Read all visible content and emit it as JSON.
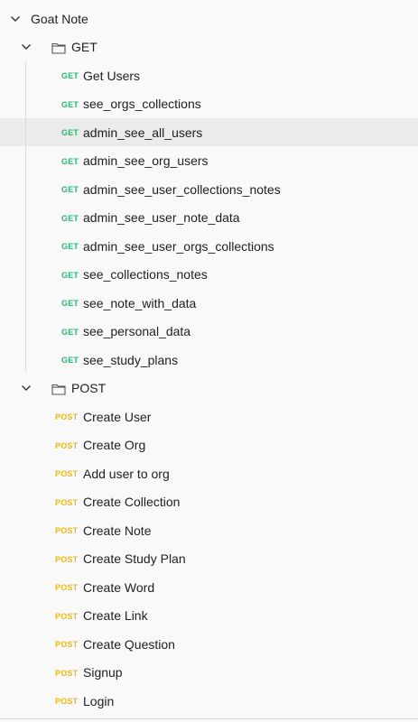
{
  "collection": {
    "name": "Goat Note",
    "expanded": true
  },
  "folders": [
    {
      "name": "GET",
      "method_label": "GET",
      "color": "#2bb673",
      "requests": [
        {
          "name": "Get Users"
        },
        {
          "name": "see_orgs_collections"
        },
        {
          "name": "admin_see_all_users",
          "selected": true
        },
        {
          "name": "admin_see_org_users"
        },
        {
          "name": "admin_see_user_collections_notes"
        },
        {
          "name": "admin_see_user_note_data"
        },
        {
          "name": "admin_see_user_orgs_collections"
        },
        {
          "name": "see_collections_notes"
        },
        {
          "name": "see_note_with_data"
        },
        {
          "name": "see_personal_data"
        },
        {
          "name": "see_study_plans"
        }
      ]
    },
    {
      "name": "POST",
      "method_label": "POST",
      "color": "#f1b80f",
      "requests": [
        {
          "name": "Create User"
        },
        {
          "name": "Create Org"
        },
        {
          "name": "Add user to org"
        },
        {
          "name": "Create Collection"
        },
        {
          "name": "Create Note"
        },
        {
          "name": "Create Study Plan"
        },
        {
          "name": "Create Word"
        },
        {
          "name": "Create Link"
        },
        {
          "name": "Create Question"
        },
        {
          "name": "Signup"
        },
        {
          "name": "Login"
        }
      ]
    }
  ],
  "icons": {
    "chevron": "chevron-down-icon",
    "folder": "folder-icon"
  }
}
